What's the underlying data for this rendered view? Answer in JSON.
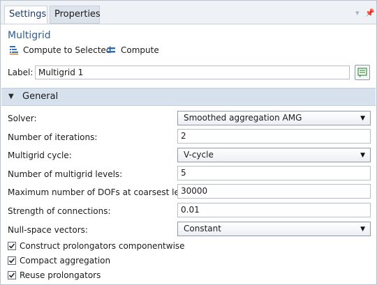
{
  "tabs": [
    {
      "label": "Settings",
      "active": true
    },
    {
      "label": "Properties",
      "active": false
    }
  ],
  "tab_controls": {
    "dropdown_icon": "chevron-down-icon",
    "pin_icon": "pin-icon"
  },
  "title": "Multigrid",
  "toolbar": {
    "compute_selected": {
      "label": "Compute to Selected",
      "icon": "compute-to-selected-icon"
    },
    "compute": {
      "label": "Compute",
      "icon": "compute-icon"
    }
  },
  "label_row": {
    "label": "Label:",
    "value": "Multigrid 1",
    "button_icon": "edit-label-icon"
  },
  "section": {
    "title": "General",
    "expanded": true
  },
  "properties": {
    "solver": {
      "label": "Solver:",
      "value": "Smoothed aggregation AMG"
    },
    "iterations": {
      "label": "Number of iterations:",
      "value": "2"
    },
    "cycle": {
      "label": "Multigrid cycle:",
      "value": "V-cycle"
    },
    "levels": {
      "label": "Number of multigrid levels:",
      "value": "5"
    },
    "max_dofs": {
      "label": "Maximum number of DOFs at coarsest level:",
      "value": "30000"
    },
    "strength": {
      "label": "Strength of connections:",
      "value": "0.01"
    },
    "null_space": {
      "label": "Null-space vectors:",
      "value": "Constant"
    }
  },
  "checkboxes": [
    {
      "label": "Construct prolongators componentwise",
      "checked": true
    },
    {
      "label": "Compact aggregation",
      "checked": true
    },
    {
      "label": "Reuse prolongators",
      "checked": true
    }
  ],
  "colors": {
    "accent": "#2e5e97",
    "section_bg": "#d7e1ee",
    "tabbar_bg": "#eef1f5"
  }
}
